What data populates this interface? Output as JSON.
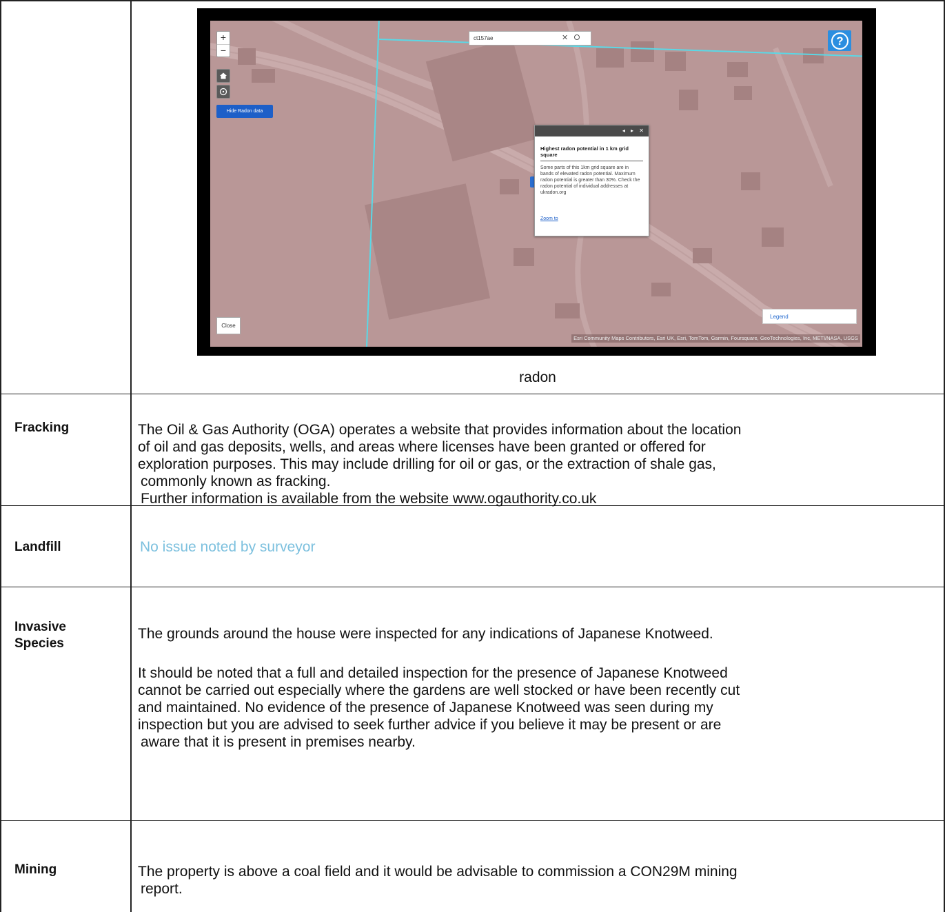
{
  "map": {
    "zoom_in": "+",
    "zoom_out": "−",
    "hide_radon_label": "Hide Radon data",
    "search_value": "ct157ae",
    "search_clear": "✕",
    "help_glyph": "?",
    "popup": {
      "nav": "◂ ▸ ✕",
      "title": "Highest radon potential in 1 km grid square",
      "text": "Some parts of this 1km grid square are in bands of elevated radon potential. Maximum radon potential is greater than 30%. Check the radon potential of individual addresses at ukradon.org",
      "link": "Zoom to"
    },
    "close_label": "Close",
    "legend_label": "Legend",
    "attribution": "Esri Community Maps Contributors, Esri UK, Esri, TomTom, Garmin, Foursquare, GeoTechnologies, Inc, METI/NASA, USGS",
    "colors": {
      "radon_overlay": "#b99797",
      "grid_line": "#5ad8e6",
      "button_blue": "#1d5fc8"
    }
  },
  "caption": "radon",
  "rows": [
    {
      "label": "Fracking",
      "lines": [
        "The Oil & Gas Authority (OGA) operates a website that provides information about the location",
        "of oil and gas deposits, wells, and areas where licenses have been granted or offered for",
        "exploration purposes. This may include drilling for oil or gas, or the extraction of shale gas,",
        "commonly known as fracking.",
        "Further information is available from the website www.ogauthority.co.uk"
      ]
    },
    {
      "label": "Landfill",
      "text": "No issue noted by surveyor",
      "text_color": "#7cc0de"
    },
    {
      "label_lines": [
        "Invasive",
        "Species"
      ],
      "para1": "The grounds around the house were inspected for any indications of Japanese Knotweed.",
      "para2_lines": [
        "It should be noted that a full and detailed inspection for the presence of Japanese Knotweed",
        "cannot be carried out especially where the gardens are well stocked or have been recently cut",
        "and maintained. No evidence of the presence of Japanese Knotweed was seen during my",
        "inspection but you are advised to seek further advice if you believe it may be present or are",
        "aware that it is present in premises nearby."
      ]
    },
    {
      "label": "Mining",
      "lines": [
        "The property is above a coal field and it would be advisable to commission a CON29M mining",
        "report."
      ]
    }
  ]
}
